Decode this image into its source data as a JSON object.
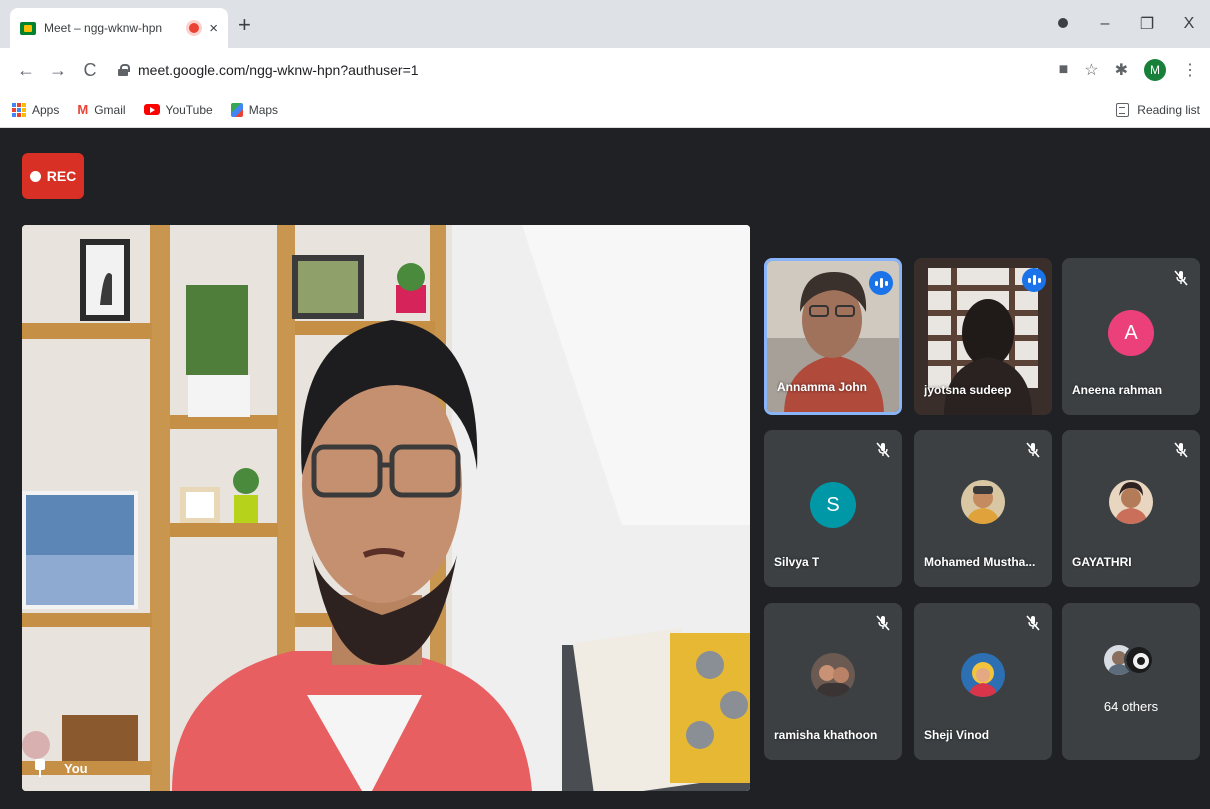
{
  "browser": {
    "tab_title": "Meet – ngg-wknw-hpn",
    "tab_close": "×",
    "new_tab": "+",
    "window_controls": {
      "minimize": "–",
      "restore": "❐",
      "close": "X"
    },
    "nav": {
      "back": "←",
      "forward": "→",
      "reload": "C"
    },
    "url": "meet.google.com/ngg-wknw-hpn?authuser=1",
    "toolbar_icons": {
      "cast": "■",
      "star": "☆",
      "extensions": "✱",
      "menu": "⋮"
    },
    "profile_initial": "M",
    "bookmarks": {
      "apps": "Apps",
      "gmail_icon": "M",
      "gmail": "Gmail",
      "youtube": "YouTube",
      "maps": "Maps"
    },
    "reading_list": "Reading list"
  },
  "meet": {
    "rec_label": "REC",
    "self_label": "You",
    "participants": [
      {
        "name": "Annamma John",
        "state": "speaking",
        "active": true
      },
      {
        "name": "jyotsna sudeep",
        "state": "speaking"
      },
      {
        "name": "Aneena rahman",
        "initial": "A",
        "avatar_color": "#ec407a",
        "state": "muted"
      },
      {
        "name": "Silvya T",
        "initial": "S",
        "avatar_color": "#0097a7",
        "state": "muted"
      },
      {
        "name": "Mohamed Mustha...",
        "state": "muted"
      },
      {
        "name": "GAYATHRI",
        "state": "muted"
      },
      {
        "name": "ramisha khathoon",
        "state": "muted"
      },
      {
        "name": "Sheji Vinod",
        "state": "muted"
      }
    ],
    "others_label": "64 others"
  },
  "colors": {
    "meet_background": "#202124",
    "tile_background": "#3c4043",
    "rec_red": "#d93025",
    "active_border": "#8ab4f8",
    "speaking_blue": "#1a73e8"
  }
}
